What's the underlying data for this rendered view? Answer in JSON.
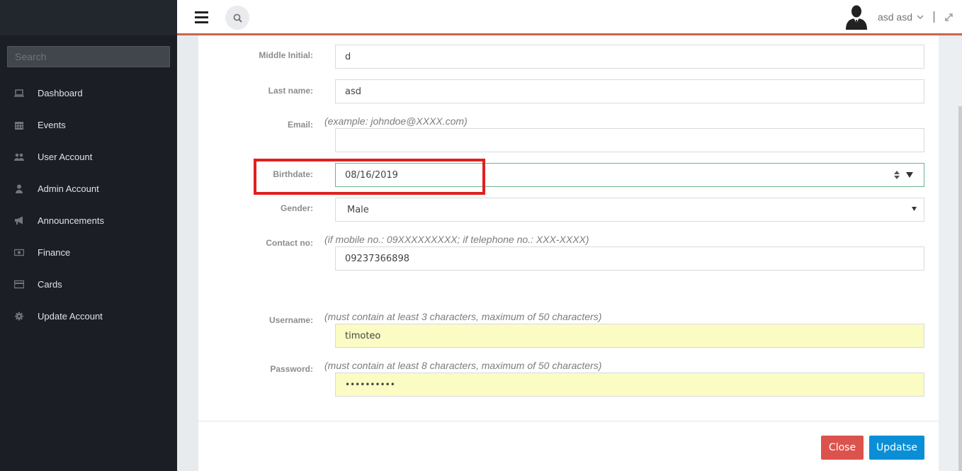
{
  "sidebar": {
    "search_placeholder": "Search",
    "items": [
      {
        "label": "Dashboard",
        "icon": "laptop-icon"
      },
      {
        "label": "Events",
        "icon": "calendar-icon"
      },
      {
        "label": "User Account",
        "icon": "users-icon"
      },
      {
        "label": "Admin Account",
        "icon": "user-icon"
      },
      {
        "label": "Announcements",
        "icon": "bullhorn-icon"
      },
      {
        "label": "Finance",
        "icon": "money-icon"
      },
      {
        "label": "Cards",
        "icon": "credit-card-icon"
      },
      {
        "label": "Update Account",
        "icon": "gear-icon"
      }
    ]
  },
  "header": {
    "user_name": "asd asd",
    "accent_color": "#c8664c"
  },
  "form": {
    "middle_initial": {
      "label": "Middle Initial:",
      "value": "d"
    },
    "last_name": {
      "label": "Last name:",
      "value": "asd"
    },
    "email": {
      "label": "Email:",
      "hint": "(example: johndoe@XXXX.com)",
      "value": ""
    },
    "birthdate": {
      "label": "Birthdate:",
      "value": "08/16/2019"
    },
    "gender": {
      "label": "Gender:",
      "value": "Male"
    },
    "contact": {
      "label": "Contact no:",
      "hint": "(if mobile no.: 09XXXXXXXXX; if telephone no.: XXX-XXXX)",
      "value": "09237366898"
    },
    "username": {
      "label": "Username:",
      "hint": "(must contain at least 3 characters, maximum of 50 characters)",
      "value": "timoteo"
    },
    "password": {
      "label": "Password:",
      "hint": "(must contain at least 8 characters, maximum of 50 characters)",
      "value": "••••••••••"
    }
  },
  "buttons": {
    "close_label": "Close",
    "update_label": "Updatse",
    "close_color": "#dc534e",
    "update_color": "#0a8fd6"
  }
}
